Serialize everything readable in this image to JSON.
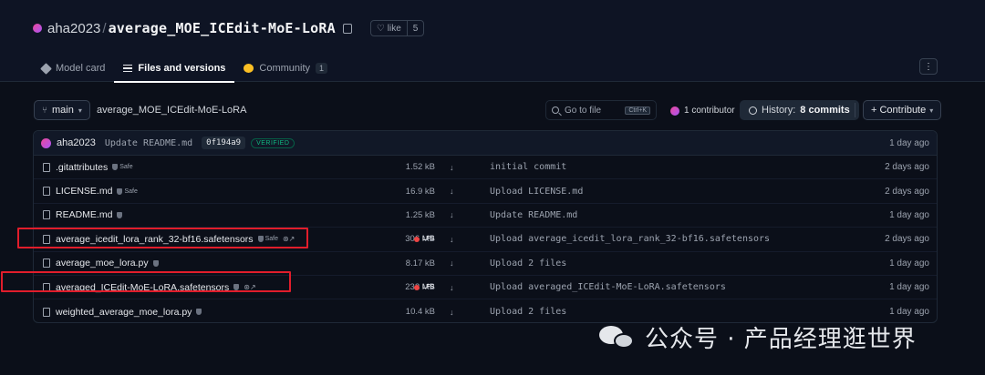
{
  "repo": {
    "owner": "aha2023",
    "name": "average_MOE_ICEdit-MoE-LoRA",
    "like_label": "like",
    "like_count": "5"
  },
  "tabs": [
    {
      "label": "Model card",
      "icon": "cube-icon"
    },
    {
      "label": "Files and versions",
      "icon": "files-icon",
      "active": true
    },
    {
      "label": "Community",
      "icon": "community-icon",
      "badge": "1"
    }
  ],
  "more_label": "⋮",
  "path_bar": {
    "branch": "main",
    "path": "average_MOE_ICEdit-MoE-LoRA",
    "goto_placeholder": "Go to file",
    "goto_shortcut": "Ctrl+K",
    "contributors": "1 contributor",
    "history_prefix": "History:",
    "history_count": "8 commits",
    "contribute": "+ Contribute"
  },
  "last_commit": {
    "author": "aha2023",
    "message": "Update README.md",
    "hash": "0f194a9",
    "verified": "VERIFIED",
    "time": "1 day ago"
  },
  "files": [
    {
      "name": "gitattributes",
      "display": ".gitattributes",
      "safe": "Safe",
      "size": "1.52 kB",
      "lfs": "",
      "commit": "initial commit",
      "time": "2 days ago"
    },
    {
      "name": "LICENSE.md",
      "display": "LICENSE.md",
      "safe": "Safe",
      "size": "16.9 kB",
      "lfs": "",
      "commit": "Upload LICENSE.md",
      "time": "2 days ago"
    },
    {
      "name": "README.md",
      "display": "README.md",
      "safe": "",
      "size": "1.25 kB",
      "lfs": "",
      "commit": "Update README.md",
      "time": "1 day ago"
    },
    {
      "name": "average_icedit_lora_rank_32-bf16.safetensors",
      "display": "average_icedit_lora_rank_32-bf16.safetensors",
      "safe": "Safe",
      "size": "306 MB",
      "lfs": "LFS",
      "commit": "Upload average_icedit_lora_rank_32-bf16.safetensors",
      "time": "2 days ago"
    },
    {
      "name": "average_moe_lora.py",
      "display": "average_moe_lora.py",
      "safe": "",
      "size": "8.17 kB",
      "lfs": "",
      "commit": "Upload 2 files",
      "time": "1 day ago"
    },
    {
      "name": "averaged_ICEdit-MoE-LoRA.safetensors",
      "display": "averaged_ICEdit-MoE-LoRA.safetensors",
      "safe": "",
      "size": "232 MB",
      "lfs": "LFS",
      "commit": "Upload averaged_ICEdit-MoE-LoRA.safetensors",
      "time": "1 day ago"
    },
    {
      "name": "weighted_average_moe_lora.py",
      "display": "weighted_average_moe_lora.py",
      "safe": "",
      "size": "10.4 kB",
      "lfs": "",
      "commit": "Upload 2 files",
      "time": "1 day ago"
    }
  ],
  "download_glyph": "↓",
  "watermark": "公众号 · 产品经理逛世界",
  "colors": {
    "background": "#0b0f19",
    "highlight": "#e11d2b",
    "verified": "#10b981",
    "lfs": "#ef4444"
  }
}
